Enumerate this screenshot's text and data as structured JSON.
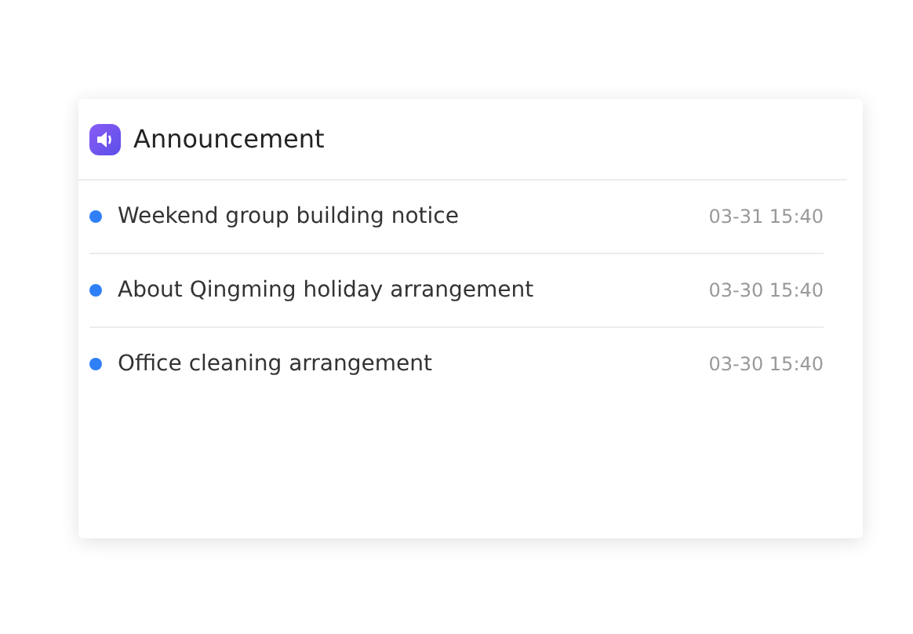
{
  "card": {
    "title": "Announcement"
  },
  "items": [
    {
      "title": "Weekend group building notice",
      "time": "03-31 15:40"
    },
    {
      "title": "About Qingming holiday arrangement",
      "time": "03-30 15:40"
    },
    {
      "title": "Office cleaning arrangement",
      "time": "03-30 15:40"
    }
  ]
}
